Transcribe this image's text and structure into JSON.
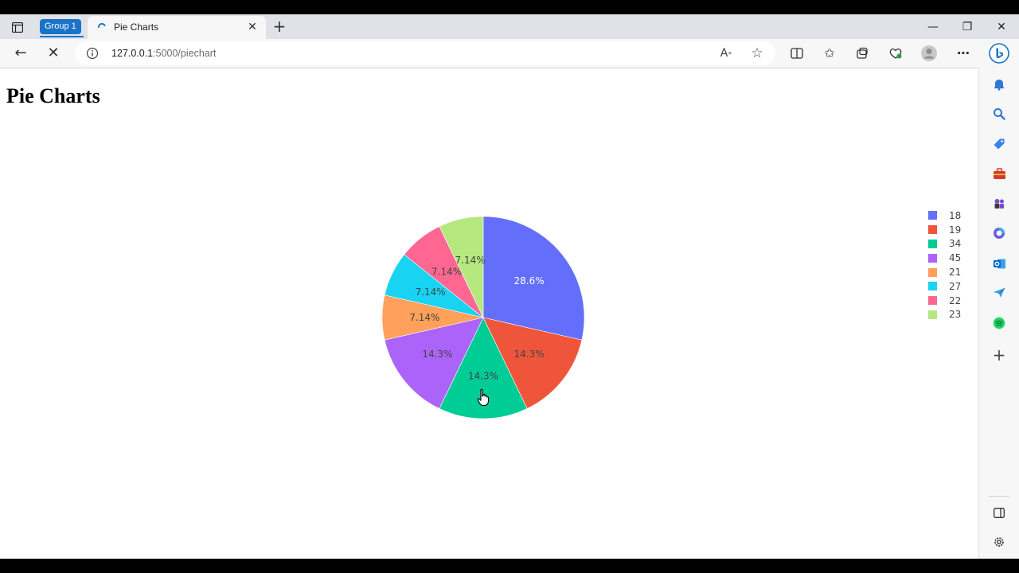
{
  "browser": {
    "tab_group_label": "Group 1",
    "tab_title": "Pie Charts",
    "url_host": "127.0.0.1",
    "url_rest": ":5000/piechart"
  },
  "page": {
    "title": "Pie Charts"
  },
  "chart_data": {
    "type": "pie",
    "title": "",
    "labels": [
      "18",
      "19",
      "34",
      "45",
      "21",
      "27",
      "22",
      "23"
    ],
    "percent_labels": [
      "28.6%",
      "14.3%",
      "14.3%",
      "14.3%",
      "7.14%",
      "7.14%",
      "7.14%",
      "7.14%"
    ],
    "values": [
      2,
      1,
      1,
      1,
      0.5,
      0.5,
      0.5,
      0.5
    ],
    "colors": [
      "#636efa",
      "#ef553b",
      "#00cc96",
      "#ab63fa",
      "#ffa15a",
      "#19d3f3",
      "#ff6692",
      "#b6e880"
    ],
    "label_colors": [
      "#ffffff",
      "#444444",
      "#444444",
      "#444444",
      "#444444",
      "#444444",
      "#444444",
      "#444444"
    ],
    "direction": "clockwise",
    "legend_position": "right"
  }
}
